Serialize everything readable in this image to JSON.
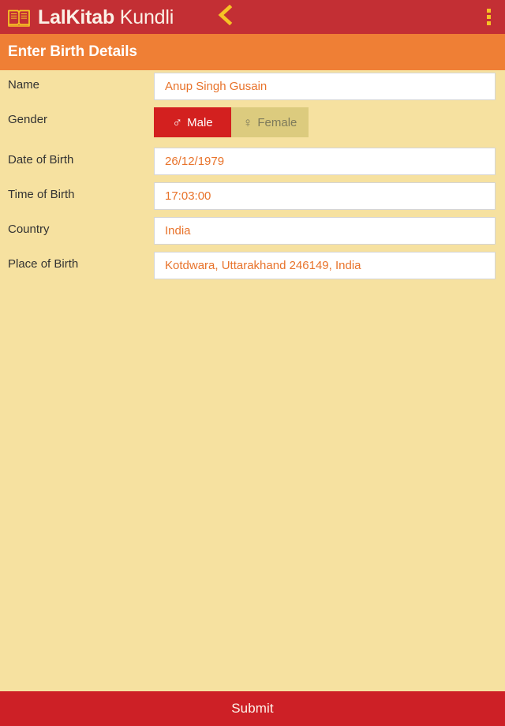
{
  "appbar": {
    "brand_bold": "LalKitab",
    "brand_light": "Kundli",
    "logo_icon": "open-book-icon",
    "back_icon": "back-chevron-icon",
    "overflow_icon": "overflow-menu-icon",
    "background_color": "#c32f34",
    "accent_color": "#f6c325"
  },
  "subheader": {
    "title": "Enter Birth Details",
    "background_color": "#ef7f35"
  },
  "form": {
    "background_color": "#f6e1a0",
    "value_color": "#e8732b",
    "fields": [
      {
        "label": "Name",
        "value": "Anup Singh Gusain",
        "placeholder": "Name"
      },
      {
        "label": "Date of Birth",
        "value": "26/12/1979",
        "placeholder": "Date of Birth"
      },
      {
        "label": "Time of Birth",
        "value": "17:03:00",
        "placeholder": "Time of Birth"
      },
      {
        "label": "Country",
        "value": "India",
        "placeholder": "Country"
      },
      {
        "label": "Place of Birth",
        "value": "Kotdwara, Uttarakhand 246149, India",
        "placeholder": "Place of Birth"
      }
    ],
    "gender": {
      "label": "Gender",
      "selected": "Male",
      "options": [
        {
          "label": "Male",
          "symbol": "♂",
          "icon": "male-symbol-icon",
          "selected": true
        },
        {
          "label": "Female",
          "symbol": "♀",
          "icon": "female-symbol-icon",
          "selected": false
        }
      ],
      "selected_color": "#d3201f",
      "unselected_color": "#dccb7e"
    }
  },
  "footer": {
    "submit_label": "Submit",
    "background_color": "#cd2026"
  }
}
